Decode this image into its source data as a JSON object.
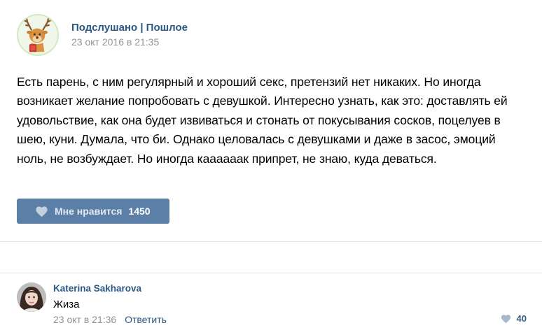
{
  "post": {
    "group_name": "Подслушано | Пошлое",
    "date": "23 окт 2016 в 21:35",
    "text": "Есть парень, с ним регулярный и хороший секс, претензий нет никаких. Но иногда возникает желание попробовать с девушкой. Интересно узнать, как это: доставлять ей удовольствие, как она будет извиваться и стонать от покусывания сосков, поцелуев в шею, куни. Думала, что би. Однако целовалась с девушками и даже в засос, эмоций ноль, не возбуждает. Но иногда каааааак припрет, не знаю, куда деваться.",
    "like_label": "Мне нравится",
    "like_count": "1450",
    "avatar_icon": "reindeer-avatar",
    "like_icon": "heart-icon"
  },
  "comment": {
    "author": "Katerina Sakharova",
    "text": "Жиза",
    "date": "23 окт в 21:36",
    "reply_label": "Ответить",
    "like_count": "40",
    "avatar_icon": "user-photo-avatar",
    "like_icon": "heart-icon"
  },
  "colors": {
    "link": "#2a5885",
    "like_button": "#5b7fa6",
    "meta": "#939393",
    "divider": "#e7e8ec"
  }
}
